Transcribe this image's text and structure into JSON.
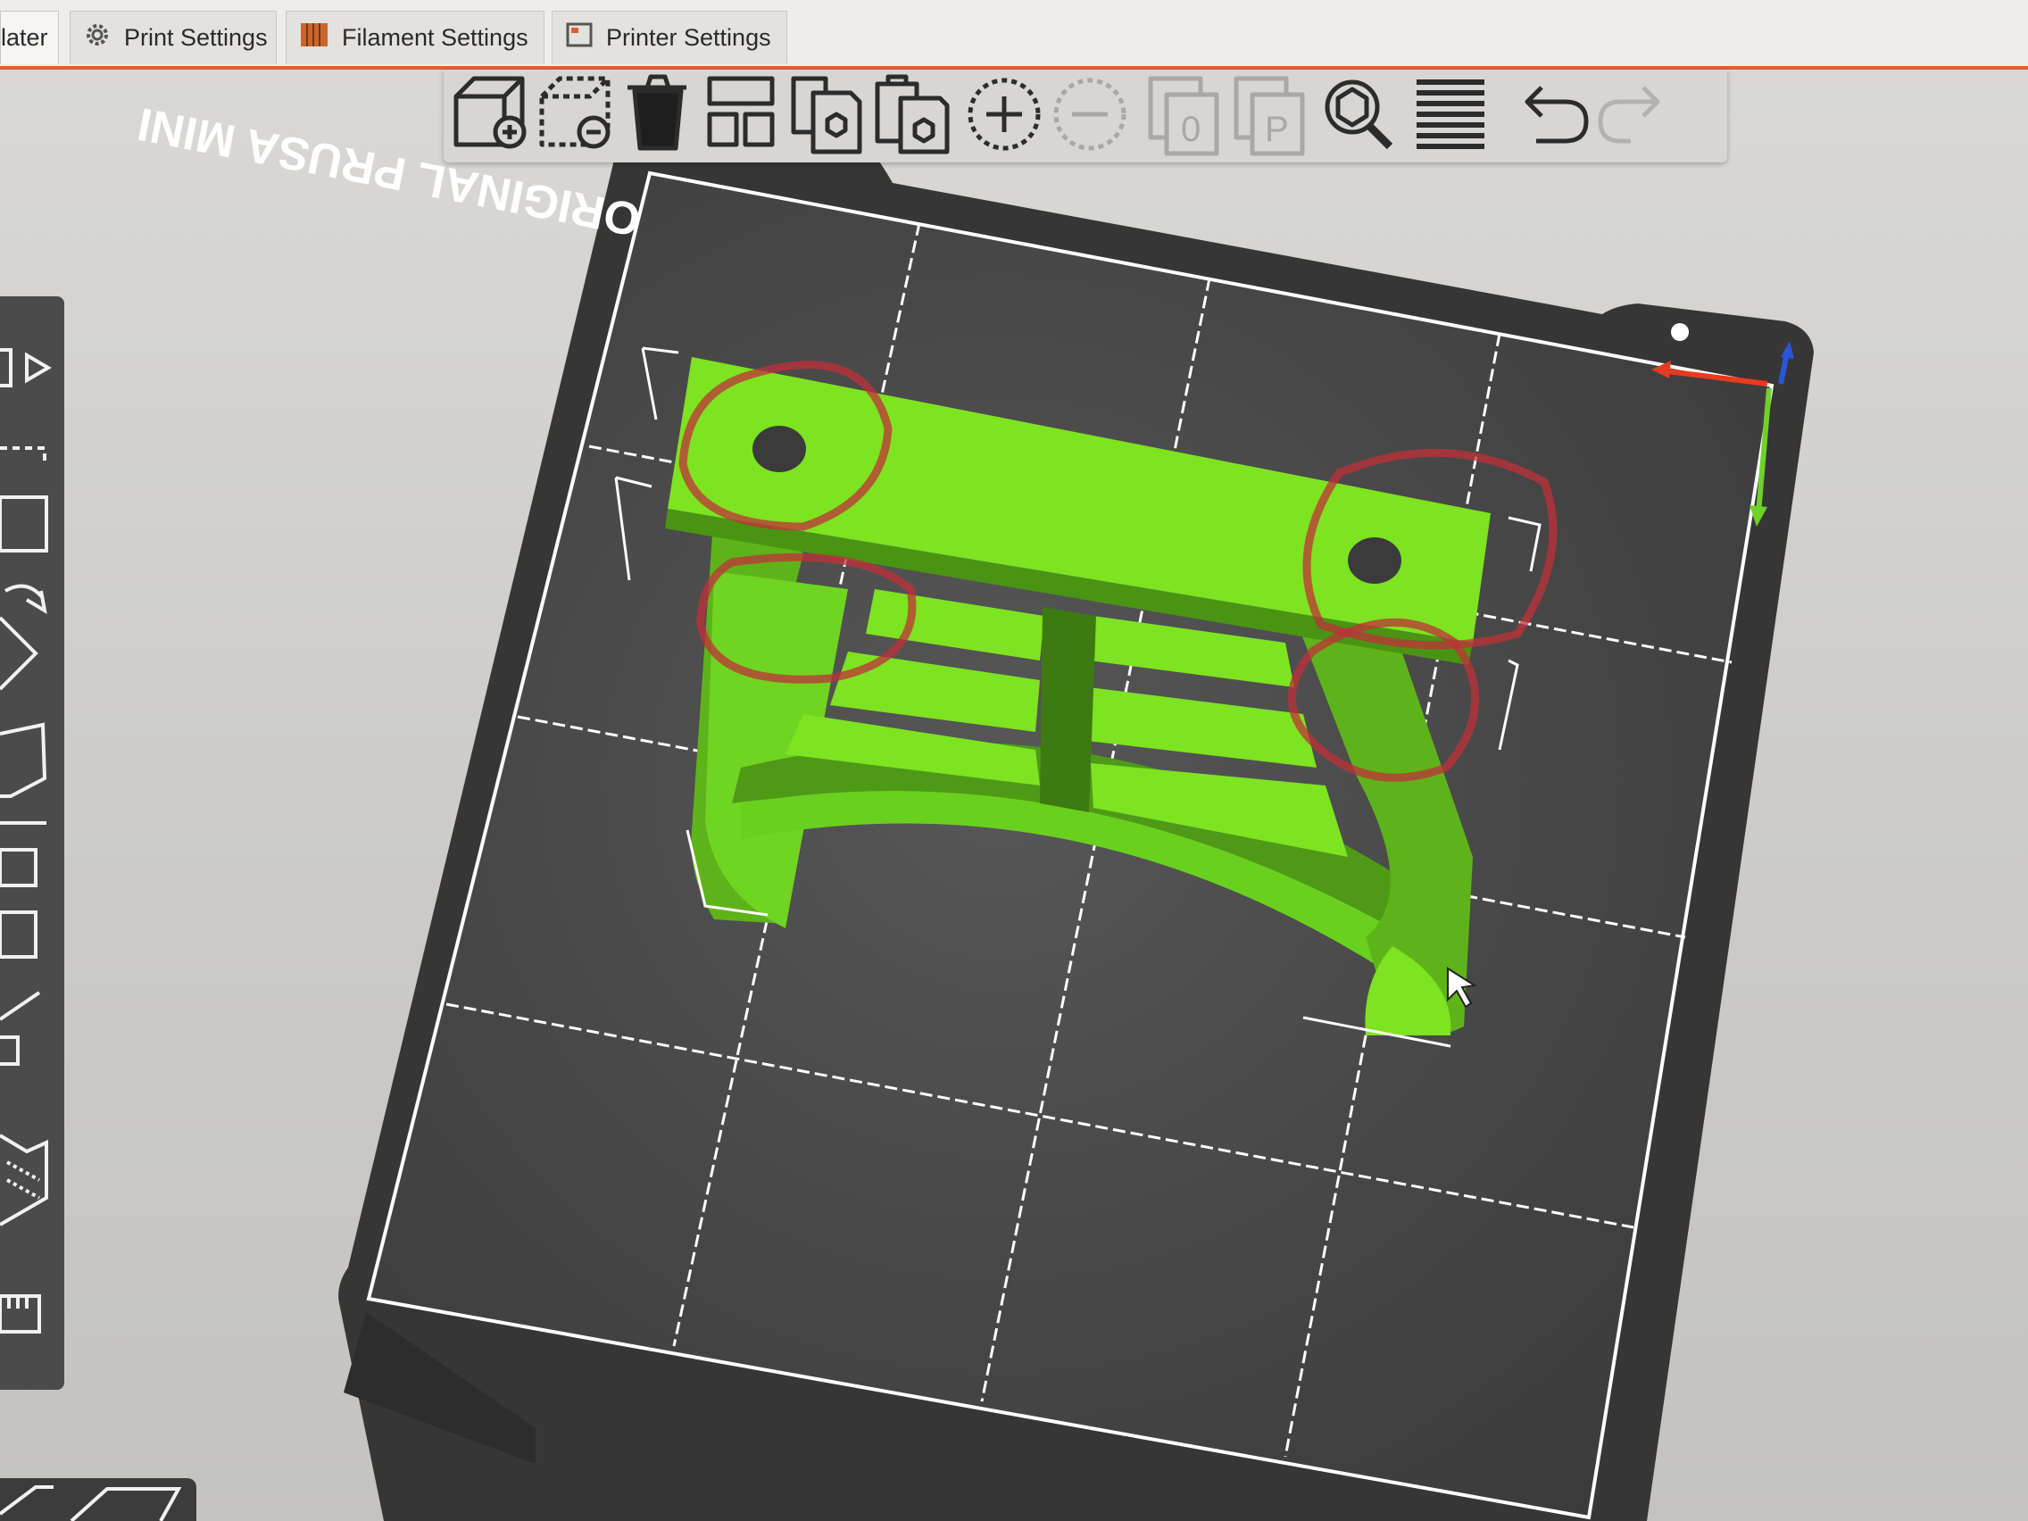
{
  "window": {
    "tabs": [
      {
        "label": "later",
        "icon": "plater-tab"
      },
      {
        "label": "Print Settings",
        "icon": "gear-icon"
      },
      {
        "label": "Filament Settings",
        "icon": "filament-spool-icon"
      },
      {
        "label": "Printer Settings",
        "icon": "printer-icon"
      }
    ]
  },
  "toolbar": {
    "buttons": [
      {
        "name": "add-object",
        "icon": "cube-plus-icon"
      },
      {
        "name": "delete-object",
        "icon": "cube-minus-icon"
      },
      {
        "name": "delete-all",
        "icon": "trash-icon"
      },
      {
        "name": "arrange",
        "icon": "arrange-icon"
      },
      {
        "name": "copy",
        "icon": "copy-icon"
      },
      {
        "name": "paste",
        "icon": "paste-icon"
      },
      {
        "name": "add-instance",
        "icon": "plus-circle-icon"
      },
      {
        "name": "remove-instance",
        "icon": "minus-circle-icon",
        "disabled": true
      },
      {
        "name": "split-to-objects",
        "icon": "split-objects-icon",
        "disabled": true
      },
      {
        "name": "split-to-parts",
        "icon": "split-parts-icon",
        "disabled": true
      },
      {
        "name": "search",
        "icon": "search-icon"
      },
      {
        "name": "variable-layer-height",
        "icon": "layers-icon"
      },
      {
        "name": "undo",
        "icon": "undo-icon"
      },
      {
        "name": "redo",
        "icon": "redo-icon",
        "disabled": true
      }
    ]
  },
  "left_toolbar": {
    "buttons": [
      "move-icon",
      "scale-icon",
      "rotate-icon",
      "place-on-face-icon",
      "cut-icon",
      "paint-supports-icon",
      "seam-paint-icon",
      "measure-icon",
      "view-cube-icon",
      "ruler-icon"
    ]
  },
  "bed": {
    "logo_text": "ORIGINAL PRUSA MINI",
    "bed_color": "#3f3f3f",
    "model_color": "#7ee321",
    "annotation_color": "#c0303a"
  },
  "axes": {
    "x_color": "#e53b1f",
    "y_color": "#6fd12a",
    "z_color": "#2a55d8"
  }
}
